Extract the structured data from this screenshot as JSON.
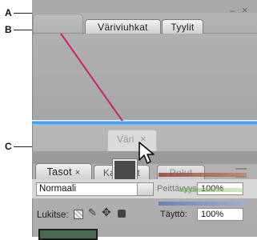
{
  "callouts": {
    "a": "A",
    "b": "B",
    "c": "C"
  },
  "top_panel": {
    "tabs": [
      "Väriviuhkat",
      "Tyylit"
    ],
    "minimize_glyph": "–",
    "close_glyph": "×"
  },
  "drag_ghost": {
    "tab_label": "Väri",
    "close_glyph": "×"
  },
  "layers_panel": {
    "tabs": [
      "Tasot",
      "Kanavat",
      "Polut"
    ],
    "tab_close_glyph": "×",
    "blend_mode": "Normaali",
    "opacity_label": "Peittävyys:",
    "opacity_value": "100%",
    "lock_label": "Lukitse:",
    "fill_label": "Täyttö:",
    "fill_value": "100%",
    "minimize_glyph": "–",
    "close_glyph": "×"
  },
  "colors": {
    "panel_gray": "#aaaaaa",
    "drop_zone_blue": "#2a8ef0",
    "arrow_pink": "#d0206a"
  },
  "icons": [
    "arrow-cursor-icon",
    "lock-transparent-icon",
    "lock-brush-icon",
    "lock-move-icon",
    "lock-all-icon",
    "panel-menu-icon"
  ]
}
